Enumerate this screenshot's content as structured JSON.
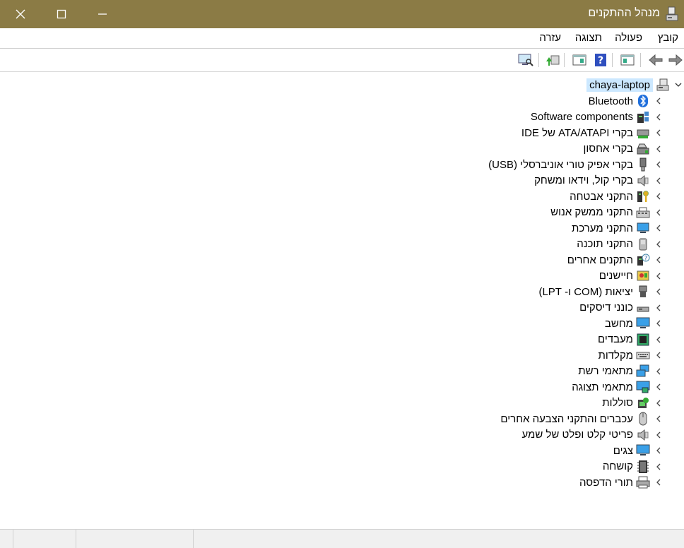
{
  "window": {
    "title": "מנהל ההתקנים"
  },
  "menu": {
    "file": "קובץ",
    "action": "פעולה",
    "view": "תצוגה",
    "help": "עזרה"
  },
  "tree": {
    "root": "chaya-laptop",
    "items": [
      {
        "label": "Bluetooth",
        "icon": "bluetooth-icon"
      },
      {
        "label": "Software components",
        "icon": "software-components-icon"
      },
      {
        "label": "בקרי ATA/ATAPI של IDE",
        "icon": "ide-controller-icon"
      },
      {
        "label": "בקרי אחסון",
        "icon": "storage-controller-icon"
      },
      {
        "label": "בקרי אפיק טורי אוניברסלי (USB)",
        "icon": "usb-icon"
      },
      {
        "label": "בקרי קול, וידאו ומשחק",
        "icon": "speaker-icon"
      },
      {
        "label": "התקני אבטחה",
        "icon": "security-device-icon"
      },
      {
        "label": "התקני ממשק אנוש",
        "icon": "hid-icon"
      },
      {
        "label": "התקני מערכת",
        "icon": "system-device-icon"
      },
      {
        "label": "התקני תוכנה",
        "icon": "software-device-icon"
      },
      {
        "label": "התקנים אחרים",
        "icon": "other-devices-icon"
      },
      {
        "label": "חיישנים",
        "icon": "sensor-icon"
      },
      {
        "label": "יציאות (COM ו- LPT)",
        "icon": "port-icon"
      },
      {
        "label": "כונני דיסקים",
        "icon": "disk-drive-icon"
      },
      {
        "label": "מחשב",
        "icon": "computer-icon"
      },
      {
        "label": "מעבדים",
        "icon": "processor-icon"
      },
      {
        "label": "מקלדות",
        "icon": "keyboard-icon"
      },
      {
        "label": "מתאמי רשת",
        "icon": "network-adapter-icon"
      },
      {
        "label": "מתאמי תצוגה",
        "icon": "display-adapter-icon"
      },
      {
        "label": "סוללות",
        "icon": "battery-icon"
      },
      {
        "label": "עכברים והתקני הצבעה אחרים",
        "icon": "mouse-icon"
      },
      {
        "label": "פריטי קלט ופלט של שמע",
        "icon": "audio-io-icon"
      },
      {
        "label": "צגים",
        "icon": "monitor-icon"
      },
      {
        "label": "קושחה",
        "icon": "firmware-icon"
      },
      {
        "label": "תורי הדפסה",
        "icon": "printer-icon"
      }
    ]
  }
}
